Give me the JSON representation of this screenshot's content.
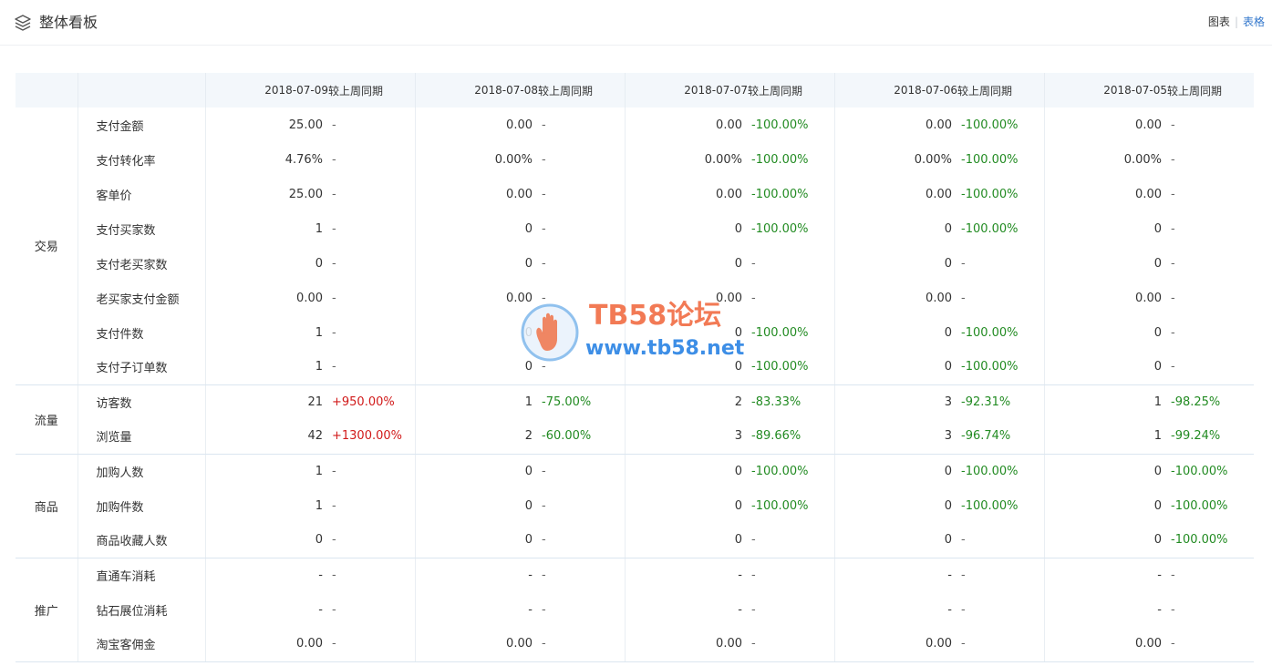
{
  "header": {
    "title": "整体看板",
    "view_chart": "图表",
    "view_separator": "|",
    "view_table": "表格"
  },
  "table": {
    "columns": [
      {
        "date": "2018-07-09",
        "compare_label": "较上周同期"
      },
      {
        "date": "2018-07-08",
        "compare_label": "较上周同期"
      },
      {
        "date": "2018-07-07",
        "compare_label": "较上周同期"
      },
      {
        "date": "2018-07-06",
        "compare_label": "较上周同期"
      },
      {
        "date": "2018-07-05",
        "compare_label": "较上周同期"
      }
    ],
    "groups": [
      {
        "category": "交易",
        "rows": [
          {
            "metric": "支付金额",
            "cells": [
              [
                "25.00",
                "-"
              ],
              [
                "0.00",
                "-"
              ],
              [
                "0.00",
                "-100.00%"
              ],
              [
                "0.00",
                "-100.00%"
              ],
              [
                "0.00",
                "-"
              ]
            ]
          },
          {
            "metric": "支付转化率",
            "cells": [
              [
                "4.76%",
                "-"
              ],
              [
                "0.00%",
                "-"
              ],
              [
                "0.00%",
                "-100.00%"
              ],
              [
                "0.00%",
                "-100.00%"
              ],
              [
                "0.00%",
                "-"
              ]
            ]
          },
          {
            "metric": "客单价",
            "cells": [
              [
                "25.00",
                "-"
              ],
              [
                "0.00",
                "-"
              ],
              [
                "0.00",
                "-100.00%"
              ],
              [
                "0.00",
                "-100.00%"
              ],
              [
                "0.00",
                "-"
              ]
            ]
          },
          {
            "metric": "支付买家数",
            "cells": [
              [
                "1",
                "-"
              ],
              [
                "0",
                "-"
              ],
              [
                "0",
                "-100.00%"
              ],
              [
                "0",
                "-100.00%"
              ],
              [
                "0",
                "-"
              ]
            ]
          },
          {
            "metric": "支付老买家数",
            "cells": [
              [
                "0",
                "-"
              ],
              [
                "0",
                "-"
              ],
              [
                "0",
                "-"
              ],
              [
                "0",
                "-"
              ],
              [
                "0",
                "-"
              ]
            ]
          },
          {
            "metric": "老买家支付金额",
            "cells": [
              [
                "0.00",
                "-"
              ],
              [
                "0.00",
                "-"
              ],
              [
                "0.00",
                "-"
              ],
              [
                "0.00",
                "-"
              ],
              [
                "0.00",
                "-"
              ]
            ]
          },
          {
            "metric": "支付件数",
            "cells": [
              [
                "1",
                "-"
              ],
              [
                "0",
                "-"
              ],
              [
                "0",
                "-100.00%"
              ],
              [
                "0",
                "-100.00%"
              ],
              [
                "0",
                "-"
              ]
            ]
          },
          {
            "metric": "支付子订单数",
            "cells": [
              [
                "1",
                "-"
              ],
              [
                "0",
                "-"
              ],
              [
                "0",
                "-100.00%"
              ],
              [
                "0",
                "-100.00%"
              ],
              [
                "0",
                "-"
              ]
            ]
          }
        ]
      },
      {
        "category": "流量",
        "rows": [
          {
            "metric": "访客数",
            "cells": [
              [
                "21",
                "+950.00%"
              ],
              [
                "1",
                "-75.00%"
              ],
              [
                "2",
                "-83.33%"
              ],
              [
                "3",
                "-92.31%"
              ],
              [
                "1",
                "-98.25%"
              ]
            ]
          },
          {
            "metric": "浏览量",
            "cells": [
              [
                "42",
                "+1300.00%"
              ],
              [
                "2",
                "-60.00%"
              ],
              [
                "3",
                "-89.66%"
              ],
              [
                "3",
                "-96.74%"
              ],
              [
                "1",
                "-99.24%"
              ]
            ]
          }
        ]
      },
      {
        "category": "商品",
        "rows": [
          {
            "metric": "加购人数",
            "cells": [
              [
                "1",
                "-"
              ],
              [
                "0",
                "-"
              ],
              [
                "0",
                "-100.00%"
              ],
              [
                "0",
                "-100.00%"
              ],
              [
                "0",
                "-100.00%"
              ]
            ]
          },
          {
            "metric": "加购件数",
            "cells": [
              [
                "1",
                "-"
              ],
              [
                "0",
                "-"
              ],
              [
                "0",
                "-100.00%"
              ],
              [
                "0",
                "-100.00%"
              ],
              [
                "0",
                "-100.00%"
              ]
            ]
          },
          {
            "metric": "商品收藏人数",
            "cells": [
              [
                "0",
                "-"
              ],
              [
                "0",
                "-"
              ],
              [
                "0",
                "-"
              ],
              [
                "0",
                "-"
              ],
              [
                "0",
                "-100.00%"
              ]
            ]
          }
        ]
      },
      {
        "category": "推广",
        "rows": [
          {
            "metric": "直通车消耗",
            "cells": [
              [
                "-",
                "-"
              ],
              [
                "-",
                "-"
              ],
              [
                "-",
                "-"
              ],
              [
                "-",
                "-"
              ],
              [
                "-",
                "-"
              ]
            ]
          },
          {
            "metric": "钻石展位消耗",
            "cells": [
              [
                "-",
                "-"
              ],
              [
                "-",
                "-"
              ],
              [
                "-",
                "-"
              ],
              [
                "-",
                "-"
              ],
              [
                "-",
                "-"
              ]
            ]
          },
          {
            "metric": "淘宝客佣金",
            "cells": [
              [
                "0.00",
                "-"
              ],
              [
                "0.00",
                "-"
              ],
              [
                "0.00",
                "-"
              ],
              [
                "0.00",
                "-"
              ],
              [
                "0.00",
                "-"
              ]
            ]
          }
        ]
      }
    ]
  },
  "colors": {
    "positive_change": "#d11a1a",
    "negative_change": "#228b22",
    "header_bg": "#f3f7fb",
    "link": "#3377cc"
  },
  "watermark": {
    "title": "TB58论坛",
    "url": "www.tb58.net"
  },
  "icons": {
    "header": "layers-icon",
    "watermark": "hand-logo-icon"
  }
}
